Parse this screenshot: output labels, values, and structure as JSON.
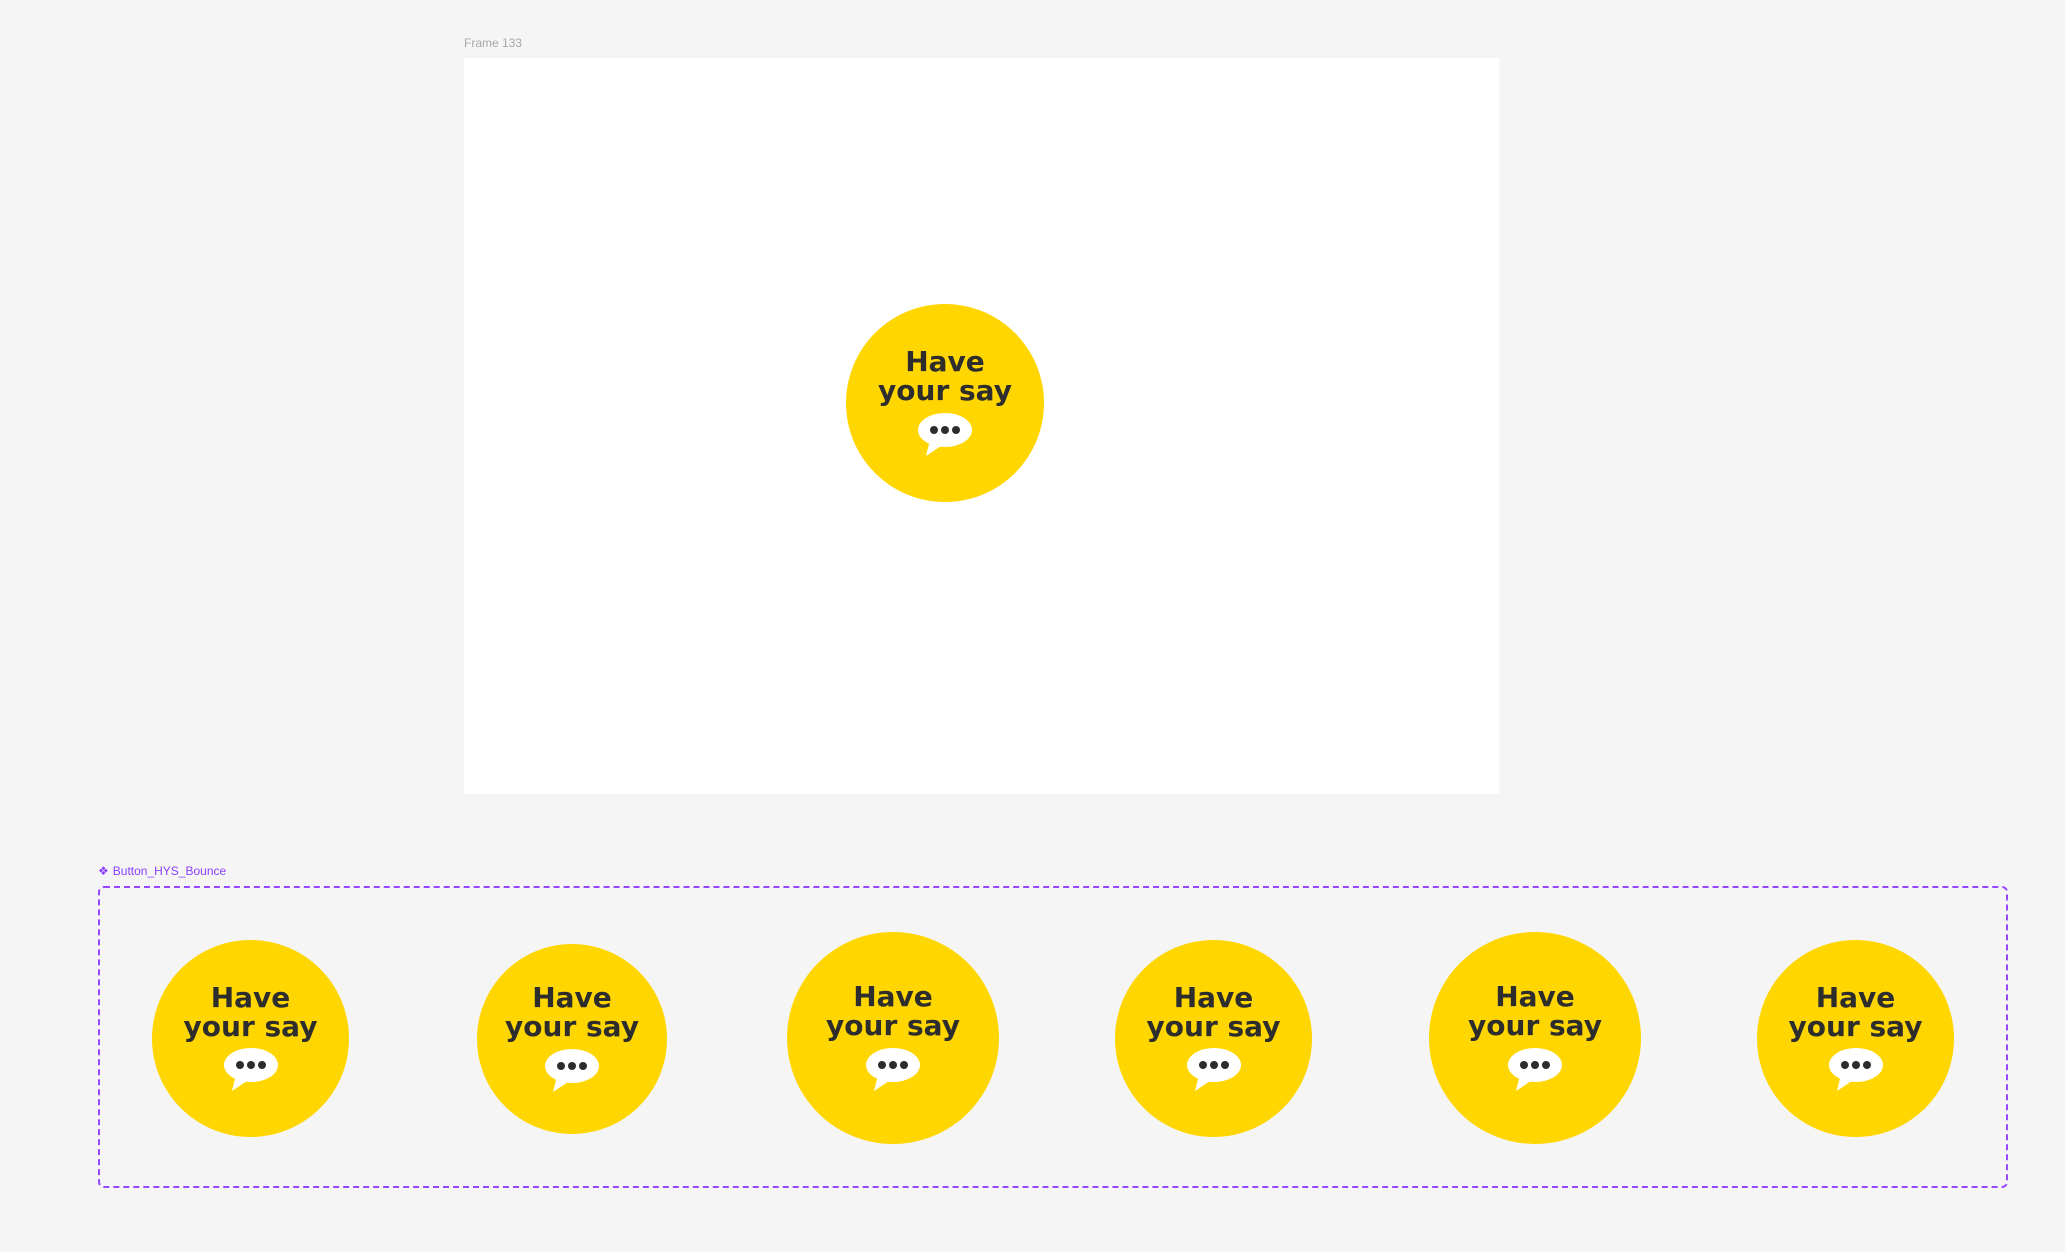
{
  "frame": {
    "label": "Frame 133"
  },
  "main_button": {
    "line1": "Have",
    "line2": "your say",
    "icon": "speech-bubble-icon"
  },
  "component": {
    "label": "Button_HYS_Bounce",
    "icon": "component-icon"
  },
  "variants": [
    {
      "line1": "Have",
      "line2": "your say",
      "icon": "speech-bubble-icon"
    },
    {
      "line1": "Have",
      "line2": "your say",
      "icon": "speech-bubble-icon"
    },
    {
      "line1": "Have",
      "line2": "your say",
      "icon": "speech-bubble-icon"
    },
    {
      "line1": "Have",
      "line2": "your say",
      "icon": "speech-bubble-icon"
    },
    {
      "line1": "Have",
      "line2": "your say",
      "icon": "speech-bubble-icon"
    },
    {
      "line1": "Have",
      "line2": "your say",
      "icon": "speech-bubble-icon"
    }
  ],
  "colors": {
    "button": "#ffd600",
    "text": "#2d2d2d",
    "component_accent": "#9747ff"
  }
}
